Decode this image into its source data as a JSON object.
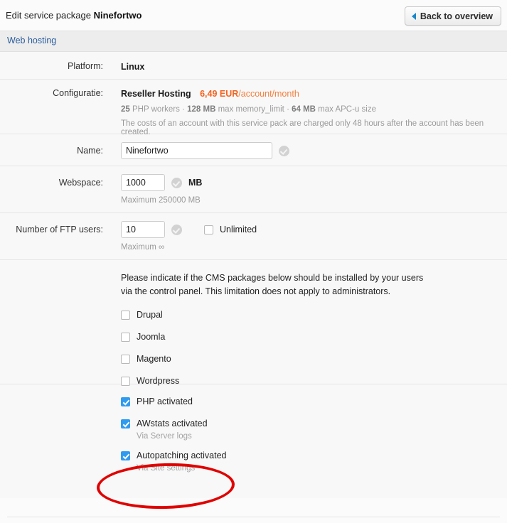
{
  "header": {
    "title_prefix": "Edit service package ",
    "title_package": "Ninefortwo",
    "back_button": "Back to overview",
    "back_icon": "triangle-left-icon"
  },
  "tabs": [
    {
      "label": "Web hosting",
      "active": true
    }
  ],
  "form": {
    "platform": {
      "label": "Platform:",
      "value": "Linux"
    },
    "configuratie": {
      "label": "Configuratie:",
      "plan": "Reseller Hosting",
      "price": "6,49 EUR",
      "price_suffix": "/account/month",
      "specs_workers_value": "25",
      "specs_workers_text": " PHP workers · ",
      "specs_mem_value": "128 MB",
      "specs_mem_text": " max memory_limit · ",
      "specs_apc_value": "64 MB",
      "specs_apc_text": " max APC-u size",
      "note": "The costs of an account with this service pack are charged only 48 hours after the account has been created."
    },
    "name": {
      "label": "Name:",
      "value": "Ninefortwo",
      "placeholder": "",
      "status_icon": "check-circle-icon"
    },
    "webspace": {
      "label": "Webspace:",
      "value": "1000",
      "unit": "MB",
      "maximum": "Maximum 250000 MB",
      "status_icon": "check-circle-icon"
    },
    "ftp_users": {
      "label": "Number of FTP users:",
      "value": "10",
      "unlimited_label": "Unlimited",
      "unlimited_checked": false,
      "maximum": "Maximum ∞",
      "status_icon": "check-circle-icon"
    }
  },
  "cms": {
    "intro_line1": "Please indicate if the CMS packages below should be installed by your users",
    "intro_line2": "via the control panel. This limitation does not apply to administrators.",
    "items": [
      {
        "label": "Drupal",
        "checked": false
      },
      {
        "label": "Joomla",
        "checked": false
      },
      {
        "label": "Magento",
        "checked": false
      },
      {
        "label": "Wordpress",
        "checked": false
      }
    ]
  },
  "features": [
    {
      "label": "PHP activated",
      "checked": true,
      "note": ""
    },
    {
      "label": "AWstats activated",
      "checked": true,
      "note": "Via Server logs"
    },
    {
      "label": "Autopatching activated",
      "checked": true,
      "note": "Via Site settings",
      "highlighted": true
    }
  ],
  "annotation": {
    "shape": "ellipse",
    "color": "#e00000",
    "targets": "Autopatching activated"
  },
  "colors": {
    "accent_blue": "#2a5d9e",
    "checkbox_blue": "#2f9bf0",
    "price_orange": "#f4621f",
    "annotation_red": "#e00000",
    "tab_band": "#ededed",
    "body_bg": "#f8f8f8"
  }
}
